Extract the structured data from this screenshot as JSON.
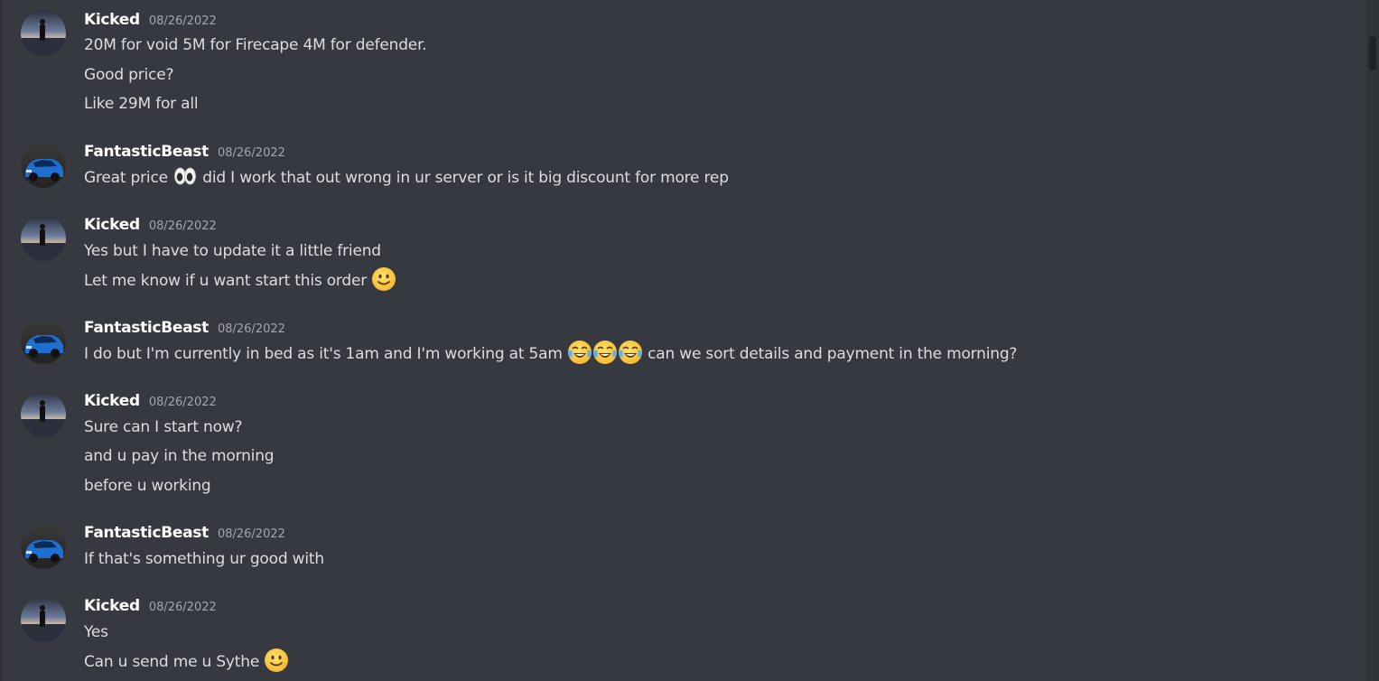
{
  "colors": {
    "background": "#36393f",
    "username": "#ffffff",
    "timestamp": "#a3a6aa",
    "message_text": "#dcddde",
    "scrollbar_thumb": "#202225"
  },
  "messages": [
    {
      "username": "Kicked",
      "timestamp": "08/26/2022",
      "avatar": "silhouette-sunset-avatar",
      "lines": [
        "20M for void 5M for Firecape 4M for defender.",
        "Good price?",
        "Like 29M for all"
      ]
    },
    {
      "username": "FantasticBeast",
      "timestamp": "08/26/2022",
      "avatar": "blue-car-avatar",
      "lines": [
        {
          "before": "Great price ",
          "emoji": "eyes-emoji",
          "after": " did I work that out wrong in ur server or is it big discount for more rep"
        }
      ]
    },
    {
      "username": "Kicked",
      "timestamp": "08/26/2022",
      "avatar": "silhouette-sunset-avatar",
      "lines": [
        "Yes but I have to update it a little friend",
        {
          "before": "Let me know if u want start this order ",
          "emoji": "slightly-smiling-face-emoji",
          "after": ""
        }
      ]
    },
    {
      "username": "FantasticBeast",
      "timestamp": "08/26/2022",
      "avatar": "blue-car-avatar",
      "lines": [
        {
          "before": "I do but I'm currently in bed as it's 1am and I'm working at 5am ",
          "emoji": "tears-of-joy-emoji x3",
          "after": " can we sort details and payment in the morning?"
        }
      ]
    },
    {
      "username": "Kicked",
      "timestamp": "08/26/2022",
      "avatar": "silhouette-sunset-avatar",
      "lines": [
        "Sure can I start now?",
        "and u pay in the morning",
        "before u working"
      ]
    },
    {
      "username": "FantasticBeast",
      "timestamp": "08/26/2022",
      "avatar": "blue-car-avatar",
      "lines": [
        "If that's something ur good with"
      ]
    },
    {
      "username": "Kicked",
      "timestamp": "08/26/2022",
      "avatar": "silhouette-sunset-avatar",
      "lines": [
        "Yes",
        {
          "before": "Can u send me u Sythe ",
          "emoji": "slightly-smiling-face-emoji",
          "after": ""
        }
      ]
    }
  ]
}
